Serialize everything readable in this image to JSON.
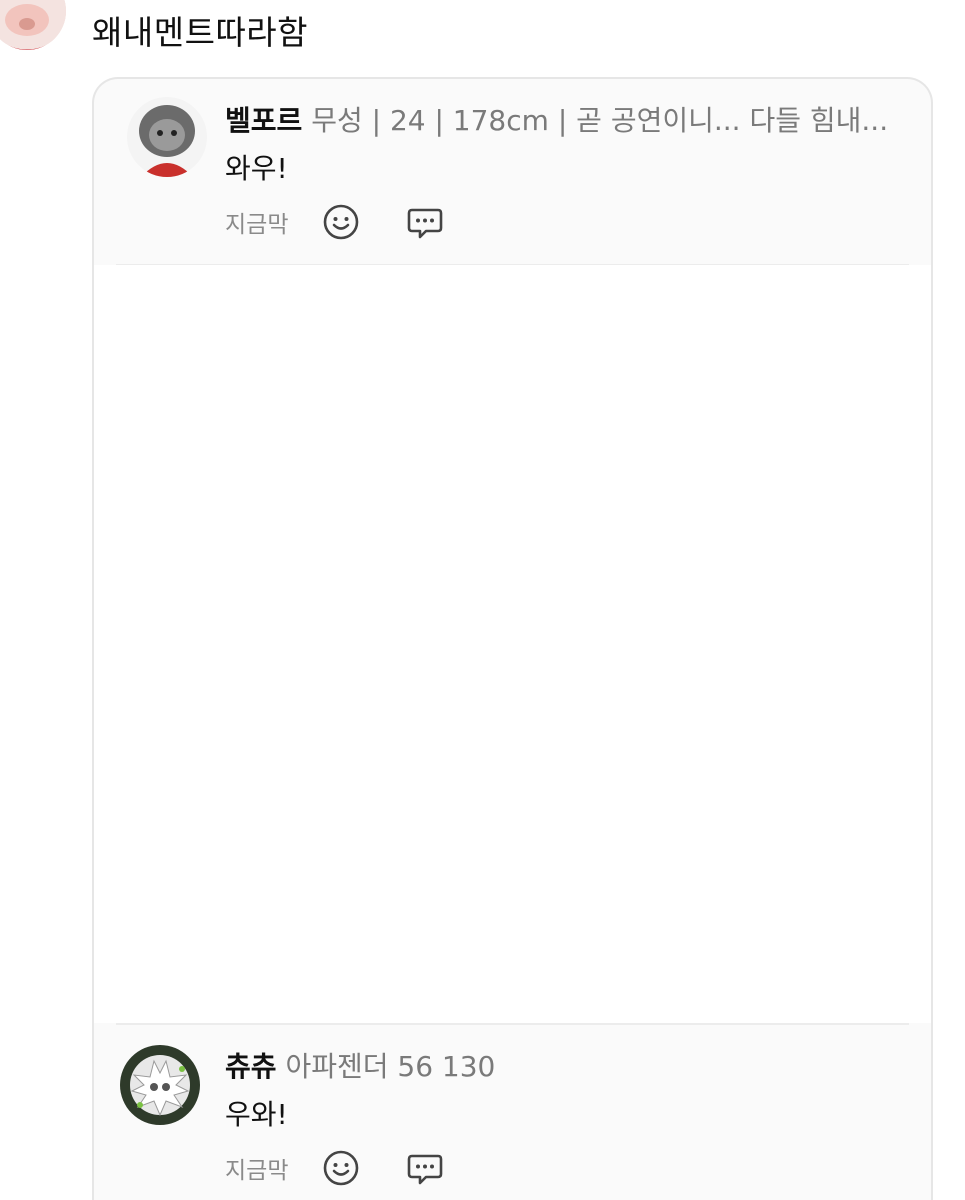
{
  "post": {
    "text": "왜내멘트따라함"
  },
  "comments": [
    {
      "name": "벨포르",
      "meta": "무성 | 24 | 178cm  |  곧 공연이니... 다들 힘내...",
      "text": "와우!",
      "time": "지금막",
      "icons": [
        "smile-icon",
        "chat-bubble-icon"
      ]
    },
    {
      "name": "츄츄",
      "meta": "아파젠더 56 130",
      "text": "우와!",
      "time": "지금막",
      "icons": [
        "smile-icon",
        "chat-bubble-icon"
      ]
    }
  ],
  "colors": {
    "card_bg": "#fafafa",
    "border": "#e6e6e6",
    "meta": "#7a7a7a"
  }
}
